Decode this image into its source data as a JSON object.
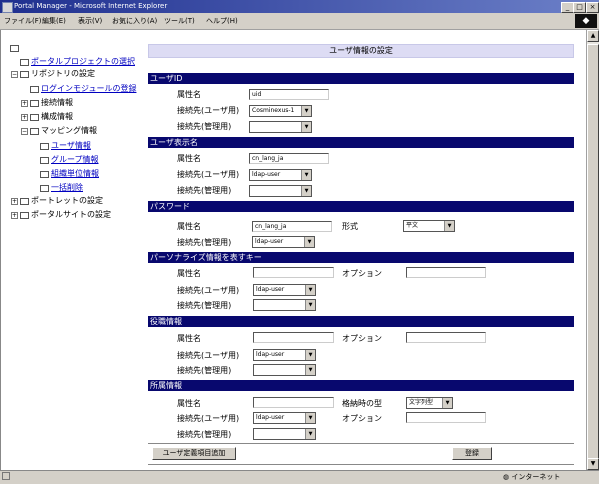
{
  "window": {
    "title": "Portal Manager - Microsoft Internet Explorer",
    "controls": [
      "_",
      "□",
      "×"
    ]
  },
  "menu": [
    "ファイル(F)",
    "編集(E)",
    "表示(V)",
    "お気に入り(A)",
    "ツール(T)",
    "ヘルプ(H)"
  ],
  "tree": {
    "items": [
      {
        "label": "ポータルプロジェクトの選択",
        "link": true
      },
      {
        "label": "リポジトリの設定",
        "link": false
      },
      {
        "label": "ログインモジュールの登録",
        "link": true
      },
      {
        "label": "接続情報",
        "link": false
      },
      {
        "label": "構成情報",
        "link": false
      },
      {
        "label": "マッピング情報",
        "link": false
      },
      {
        "label": "ユーザ情報",
        "link": true
      },
      {
        "label": "グループ情報",
        "link": true
      },
      {
        "label": "組織単位情報",
        "link": true
      },
      {
        "label": "一括削除",
        "link": true
      },
      {
        "label": "ポートレットの設定",
        "link": false
      },
      {
        "label": "ポータルサイトの設定",
        "link": false
      }
    ]
  },
  "form": {
    "title": "ユーザ情報の設定",
    "sections": {
      "userid": {
        "title": "ユーザID",
        "attr_label": "属性名",
        "attr_value": "uid",
        "conn_user_label": "接続先(ユーザ用)",
        "conn_user_value": "Cosminexus-1",
        "conn_admin_label": "接続先(管理用)",
        "conn_admin_value": ""
      },
      "display": {
        "title": "ユーザ表示名",
        "attr_label": "属性名",
        "attr_value": "cn_lang_ja",
        "conn_user_label": "接続先(ユーザ用)",
        "conn_user_value": "ldap-user",
        "conn_admin_label": "接続先(管理用)",
        "conn_admin_value": ""
      },
      "password": {
        "title": "パスワード",
        "attr_label": "属性名",
        "attr_value": "cn_lang_ja",
        "format_label": "形式",
        "format_value": "平文",
        "conn_admin_label": "接続先(管理用)",
        "conn_admin_value": "ldap-user"
      },
      "personalize": {
        "title": "パーソナライズ情報を表すキー",
        "attr_label": "属性名",
        "attr_value": "",
        "option_label": "オプション",
        "option_value": "",
        "conn_user_label": "接続先(ユーザ用)",
        "conn_user_value": "ldap-user",
        "conn_admin_label": "接続先(管理用)",
        "conn_admin_value": ""
      },
      "role": {
        "title": "役職情報",
        "attr_label": "属性名",
        "attr_value": "",
        "option_label": "オプション",
        "option_value": "",
        "conn_user_label": "接続先(ユーザ用)",
        "conn_user_value": "ldap-user",
        "conn_admin_label": "接続先(管理用)",
        "conn_admin_value": ""
      },
      "affiliation": {
        "title": "所属情報",
        "attr_label": "属性名",
        "attr_value": "",
        "type_label": "格納時の型",
        "type_value": "文字列型",
        "option_label": "オプション",
        "option_value": "",
        "conn_user_label": "接続先(ユーザ用)",
        "conn_user_value": "ldap-user",
        "conn_admin_label": "接続先(管理用)",
        "conn_admin_value": ""
      }
    },
    "add_button": "ユーザ定義項目追加",
    "register_button": "登録"
  },
  "status": {
    "zone": "インターネット"
  }
}
